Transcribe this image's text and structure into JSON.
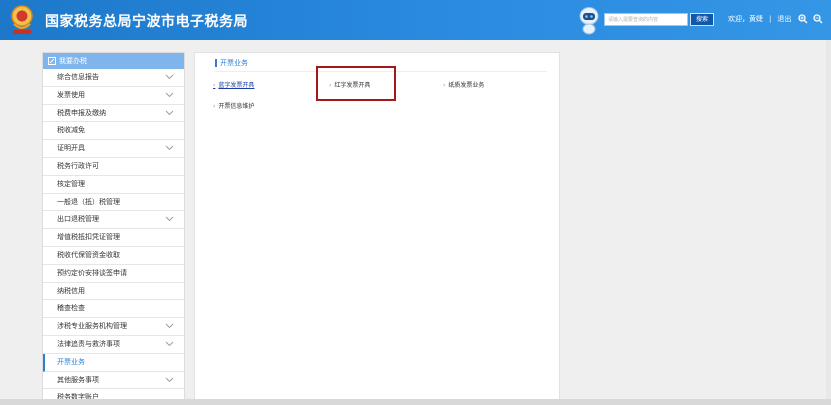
{
  "header": {
    "title": "国家税务总局宁波市电子税务局",
    "search_placeholder": "请输入需要查询的内容",
    "search_button": "搜索",
    "welcome": "欢迎，黄婕",
    "logout": "退出",
    "colors": {
      "bar": "#2a8be0",
      "search_button": "#1357a8"
    }
  },
  "sidebar": {
    "title": "我要办税",
    "items": [
      {
        "label": "综合信息报告",
        "expandable": true
      },
      {
        "label": "发票使用",
        "expandable": true
      },
      {
        "label": "税费申报及缴纳",
        "expandable": true
      },
      {
        "label": "税收减免",
        "expandable": false
      },
      {
        "label": "证明开具",
        "expandable": true
      },
      {
        "label": "税务行政许可",
        "expandable": false
      },
      {
        "label": "核定管理",
        "expandable": false
      },
      {
        "label": "一般退（抵）税管理",
        "expandable": false
      },
      {
        "label": "出口退税管理",
        "expandable": true
      },
      {
        "label": "增值税抵扣凭证管理",
        "expandable": false
      },
      {
        "label": "税收代保管资金收取",
        "expandable": false
      },
      {
        "label": "预约定价安排谈签申请",
        "expandable": false
      },
      {
        "label": "纳税信用",
        "expandable": false
      },
      {
        "label": "稽查检查",
        "expandable": false
      },
      {
        "label": "涉税专业服务机构管理",
        "expandable": true
      },
      {
        "label": "法律追责与救济事项",
        "expandable": true
      },
      {
        "label": "开票业务",
        "expandable": false,
        "active": true
      },
      {
        "label": "其他服务事项",
        "expandable": true
      },
      {
        "label": "税务数字账户",
        "expandable": false
      }
    ]
  },
  "main": {
    "section_title": "开票业务",
    "links": [
      {
        "label": "蓝字发票开具"
      },
      {
        "label": "红字发票开具"
      },
      {
        "label": "纸质发票业务"
      },
      {
        "label": "开票信息维护"
      }
    ]
  }
}
